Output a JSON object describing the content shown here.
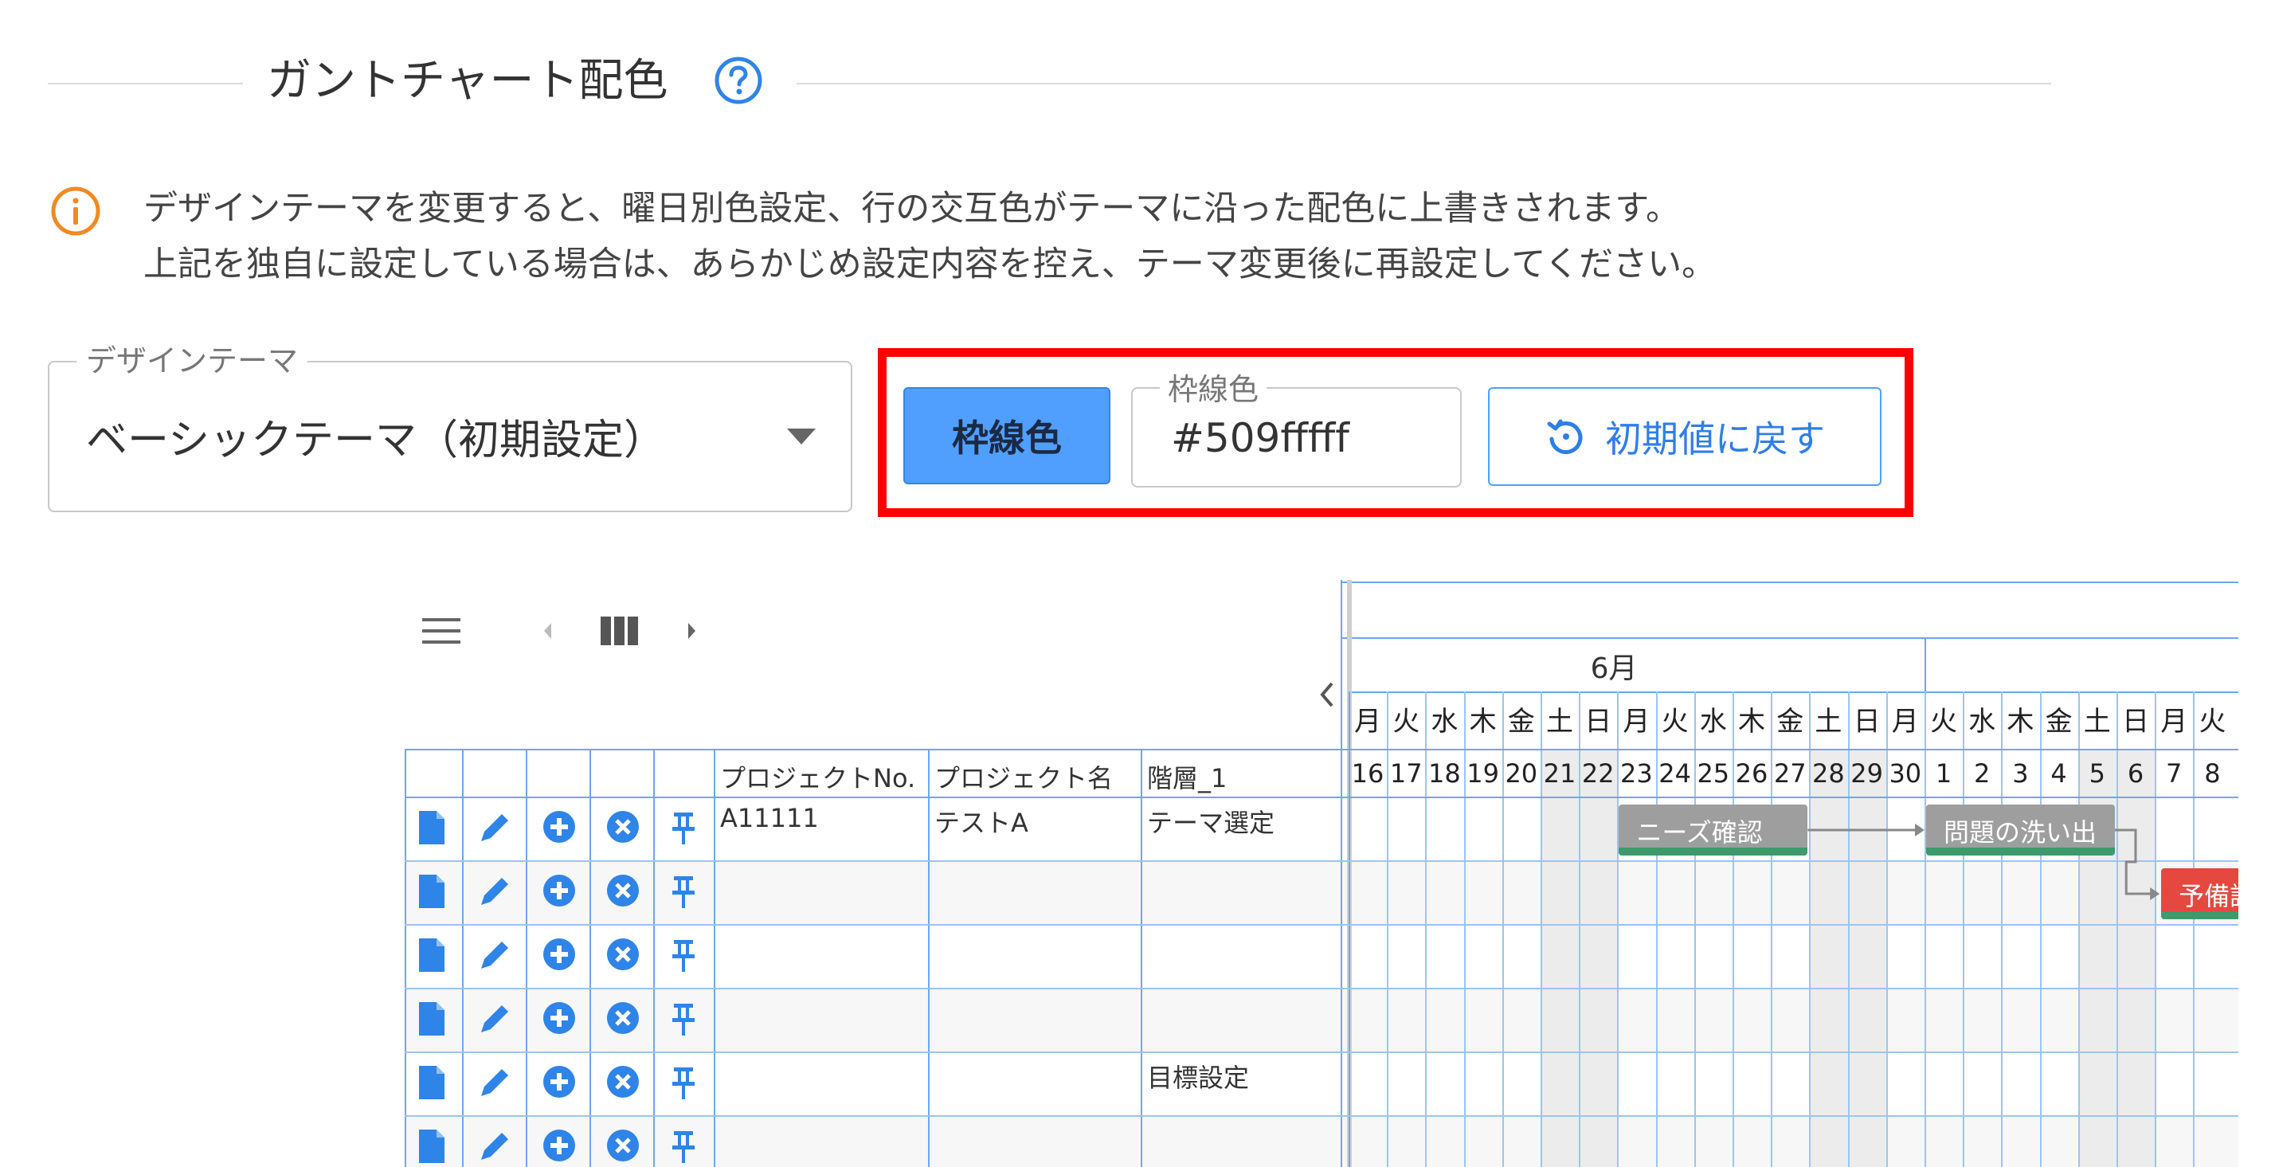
{
  "section": {
    "title": "ガントチャート配色",
    "help_icon": "question-circle-icon"
  },
  "notice": {
    "icon": "info-circle-icon",
    "line1": "デザインテーマを変更すると、曜日別色設定、行の交互色がテーマに沿った配色に上書きされます。",
    "line2": "上記を独自に設定している場合は、あらかじめ設定内容を控え、テーマ変更後に再設定してください。",
    "color": "#f08a24"
  },
  "theme_select": {
    "label": "デザインテーマ",
    "value": "ベーシックテーマ（初期設定）"
  },
  "border_color": {
    "button_label": "枠線色",
    "field_label": "枠線色",
    "value": "#509fffff",
    "swatch": "#509fff",
    "reset_label": "初期値に戻す",
    "reset_icon": "reset-icon"
  },
  "gantt": {
    "toolbar_icons": [
      "menu-icon",
      "chevron-left-icon",
      "columns-icon",
      "chevron-right-icon"
    ],
    "month": "6月",
    "weekdays": [
      "月",
      "火",
      "水",
      "木",
      "金",
      "土",
      "日",
      "月",
      "火",
      "水",
      "木",
      "金",
      "土",
      "日",
      "月",
      "火",
      "水",
      "木",
      "金",
      "土",
      "日",
      "月",
      "火"
    ],
    "days": [
      "16",
      "17",
      "18",
      "19",
      "20",
      "21",
      "22",
      "23",
      "24",
      "25",
      "26",
      "27",
      "28",
      "29",
      "30",
      "1",
      "2",
      "3",
      "4",
      "5",
      "6",
      "7",
      "8"
    ],
    "columns": [
      "プロジェクトNo.",
      "プロジェクト名",
      "階層_1"
    ],
    "row_icons": [
      "file-icon",
      "edit-icon",
      "add-circle-icon",
      "close-circle-icon",
      "pin-icon"
    ],
    "rows": [
      {
        "no": "A11111",
        "name": "テストA",
        "level1": "テーマ選定"
      },
      {
        "no": "",
        "name": "",
        "level1": ""
      },
      {
        "no": "",
        "name": "",
        "level1": ""
      },
      {
        "no": "",
        "name": "",
        "level1": ""
      },
      {
        "no": "",
        "name": "",
        "level1": "目標設定"
      },
      {
        "no": "",
        "name": "",
        "level1": ""
      }
    ],
    "bars": [
      {
        "label": "ニーズ確認",
        "color": "#9e9e9e"
      },
      {
        "label": "問題の洗い出",
        "color": "#9e9e9e"
      },
      {
        "label": "予備調",
        "color": "#e5483f"
      }
    ],
    "border_color": "#509fff"
  }
}
